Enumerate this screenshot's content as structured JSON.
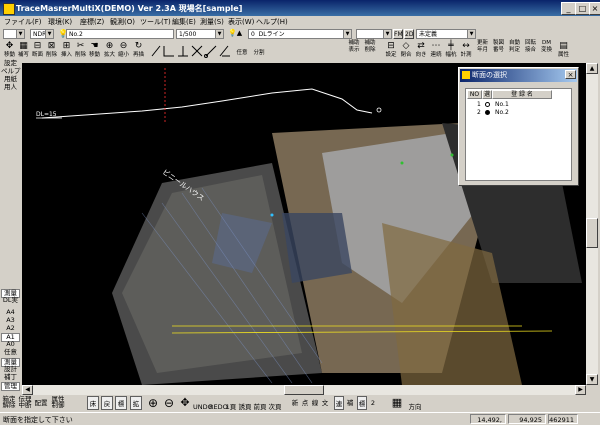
{
  "window": {
    "title": "TraceMasrerMultiX(DEMO)  Ver 2.3A  現場名[sample]"
  },
  "title_buttons": [
    "_",
    "□",
    "×"
  ],
  "menu": [
    "ファイル(F)",
    "環境(K)",
    "座標(Z)",
    "観測(O)",
    "ツール(T)",
    "編集(E)",
    "測量(S)",
    "表示(W)",
    "ヘルプ(H)"
  ],
  "toolbar1": {
    "combo_a": "",
    "combo_b": "NDR",
    "combo_point": "No.2",
    "combo_scale": "1/500",
    "combo_layer_num": "0",
    "combo_layer": "DLライン",
    "combo_extra": "",
    "btn_fm": "FM",
    "btn_2d": "2D",
    "combo_status": "未定義"
  },
  "toolbar2": {
    "tools": [
      {
        "icon": "arrows",
        "label": "移動"
      },
      {
        "icon": "grid",
        "label": "補写"
      },
      {
        "icon": "section",
        "label": "断面"
      },
      {
        "icon": "delete-pt",
        "label": "削除"
      },
      {
        "icon": "insert",
        "label": "挿入"
      },
      {
        "icon": "delete-all",
        "label": "削除"
      },
      {
        "icon": "move",
        "label": "移動"
      },
      {
        "icon": "zoom-in",
        "label": "拡大"
      },
      {
        "icon": "zoom-out",
        "label": "縮小"
      },
      {
        "icon": "redraw",
        "label": "再描"
      }
    ],
    "draw_tools": [
      "任意",
      "分割"
    ],
    "right_tools": [
      {
        "label": "補助\n表示"
      },
      {
        "label": "補助\n削除"
      },
      {
        "label": "設定"
      },
      {
        "label": "閉合"
      },
      {
        "label": "向き"
      },
      {
        "label": "連続"
      },
      {
        "label": "幅杭"
      },
      {
        "label": "計測"
      },
      {
        "label": "更新\n年月"
      },
      {
        "label": "製図\n番号"
      },
      {
        "label": "自動\n判定"
      },
      {
        "label": "回転\n接合"
      },
      {
        "label": "DM\n変換"
      },
      {
        "label": "属性"
      }
    ]
  },
  "left_panel": {
    "items": [
      {
        "label": "設定",
        "active": false
      },
      {
        "label": "ペルプ",
        "active": false
      },
      {
        "label": "用紙",
        "active": false
      },
      {
        "label": "用人",
        "active": false
      },
      {
        "label": "測量",
        "active": true
      },
      {
        "label": "DL実",
        "active": false
      },
      {
        "label": "A4",
        "active": false
      },
      {
        "label": "A3",
        "active": false
      },
      {
        "label": "A2",
        "active": false
      },
      {
        "label": "A1",
        "active": true
      },
      {
        "label": "A0",
        "active": false
      },
      {
        "label": "任意",
        "active": false
      },
      {
        "label": "測量",
        "active": true
      },
      {
        "label": "設計",
        "active": false
      },
      {
        "label": "補丁",
        "active": false
      },
      {
        "label": "管理",
        "active": true
      }
    ]
  },
  "canvas": {
    "profile_label": "DL=15",
    "overlay_label": "ビニールハウス"
  },
  "dialog": {
    "title": "断面の選択",
    "close": "×",
    "headers": [
      "NO",
      "選",
      "登 録 名"
    ],
    "rows": [
      {
        "no": "1",
        "selected": false,
        "name": "No.1"
      },
      {
        "no": "2",
        "selected": true,
        "name": "No.2"
      }
    ]
  },
  "bottom_toolbar": {
    "left": [
      "箱定\n解除",
      "伝理\n中断",
      "配置",
      "属性\n制御"
    ],
    "mid": [
      "床",
      "戻",
      "標",
      "拡"
    ],
    "zoom": [
      "⊕",
      "⊖",
      "✥"
    ],
    "undo": "UNDO",
    "redo": "REDO",
    "view": [
      "1頁",
      "誘頁",
      "前頁",
      "次頁"
    ],
    "mode": [
      "新",
      "点",
      "線",
      "文",
      "連",
      "補",
      "標",
      "2"
    ],
    "direction": "方向"
  },
  "status": {
    "message": "断面を指定して下さい",
    "x": "14,492,",
    "y": "94,925",
    "code": "462911"
  },
  "colors": {
    "title_bar": "#0a246a",
    "profile_line": "#ffffff",
    "axis_red": "#ff3030",
    "cross_yellow": "#f0e020"
  }
}
